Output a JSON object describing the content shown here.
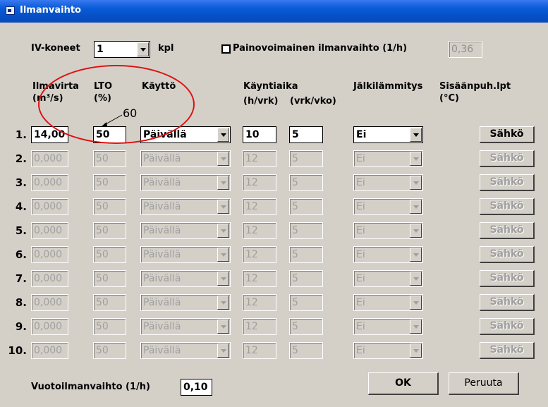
{
  "window": {
    "title": "Ilmanvaihto"
  },
  "machines": {
    "label": "IV-koneet",
    "value": "1",
    "unit": "kpl"
  },
  "gravity": {
    "label": "Painovoimainen ilmanvaihto (1/h)",
    "value": "0,36",
    "checked": false
  },
  "headers": {
    "airflow_line1": "Ilmavirta",
    "airflow_line2": "(m³/s)",
    "lto_line1": "LTO",
    "lto_line2": "(%)",
    "usage": "Käyttö",
    "runtime": "Käyntiaika",
    "runtime_hours": "(h/vrk)",
    "runtime_days": "(vrk/vko)",
    "reheating": "Jälkilämmitys",
    "supply_temp_line1": "Sisäänpuh.lpt",
    "supply_temp_line2": "(°C)"
  },
  "annotation": {
    "text": "60",
    "color": "#e01010"
  },
  "rows": [
    {
      "num": "1.",
      "airflow": "14,00",
      "lto": "50",
      "usage": "Päivällä",
      "hours": "10",
      "days": "5",
      "reheat": "Ei",
      "button": "Sähkö",
      "enabled": true
    },
    {
      "num": "2.",
      "airflow": "0,000",
      "lto": "50",
      "usage": "Päivällä",
      "hours": "12",
      "days": "5",
      "reheat": "Ei",
      "button": "Sähkö",
      "enabled": false
    },
    {
      "num": "3.",
      "airflow": "0,000",
      "lto": "50",
      "usage": "Päivällä",
      "hours": "12",
      "days": "5",
      "reheat": "Ei",
      "button": "Sähkö",
      "enabled": false
    },
    {
      "num": "4.",
      "airflow": "0,000",
      "lto": "50",
      "usage": "Päivällä",
      "hours": "12",
      "days": "5",
      "reheat": "Ei",
      "button": "Sähkö",
      "enabled": false
    },
    {
      "num": "5.",
      "airflow": "0,000",
      "lto": "50",
      "usage": "Päivällä",
      "hours": "12",
      "days": "5",
      "reheat": "Ei",
      "button": "Sähkö",
      "enabled": false
    },
    {
      "num": "6.",
      "airflow": "0,000",
      "lto": "50",
      "usage": "Päivällä",
      "hours": "12",
      "days": "5",
      "reheat": "Ei",
      "button": "Sähkö",
      "enabled": false
    },
    {
      "num": "7.",
      "airflow": "0,000",
      "lto": "50",
      "usage": "Päivällä",
      "hours": "12",
      "days": "5",
      "reheat": "Ei",
      "button": "Sähkö",
      "enabled": false
    },
    {
      "num": "8.",
      "airflow": "0,000",
      "lto": "50",
      "usage": "Päivällä",
      "hours": "12",
      "days": "5",
      "reheat": "Ei",
      "button": "Sähkö",
      "enabled": false
    },
    {
      "num": "9.",
      "airflow": "0,000",
      "lto": "50",
      "usage": "Päivällä",
      "hours": "12",
      "days": "5",
      "reheat": "Ei",
      "button": "Sähkö",
      "enabled": false
    },
    {
      "num": "10.",
      "airflow": "0,000",
      "lto": "50",
      "usage": "Päivällä",
      "hours": "12",
      "days": "5",
      "reheat": "Ei",
      "button": "Sähkö",
      "enabled": false
    }
  ],
  "leakage": {
    "label": "Vuotoilmanvaihto (1/h)",
    "value": "0,10"
  },
  "buttons": {
    "ok": "OK",
    "cancel": "Peruuta"
  }
}
